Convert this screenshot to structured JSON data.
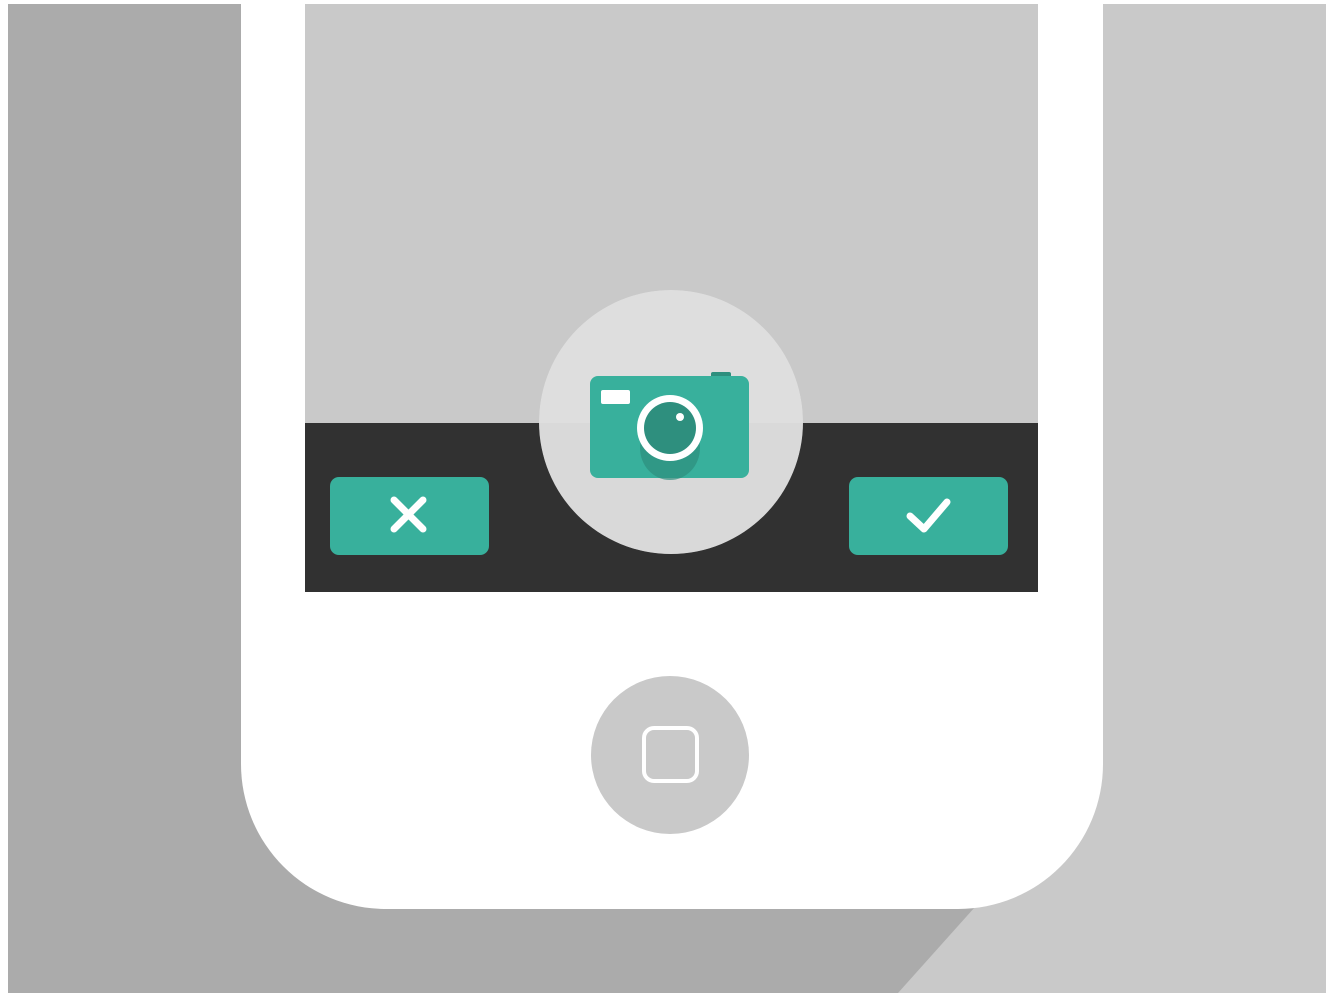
{
  "colors": {
    "background_light": "#c9c9c9",
    "background_shadow": "#ababab",
    "phone_body": "#ffffff",
    "screen_viewfinder": "#c9c9c9",
    "toolbar": "#313131",
    "accent": "#38b09c",
    "accent_dark": "#2e8f7e",
    "shutter_button": "#dcdcdc",
    "home_button": "#c9c9c9"
  },
  "toolbar": {
    "cancel_icon": "close-icon",
    "confirm_icon": "checkmark-icon",
    "shutter_icon": "camera-icon"
  },
  "device": {
    "home_icon": "rounded-square-icon"
  }
}
